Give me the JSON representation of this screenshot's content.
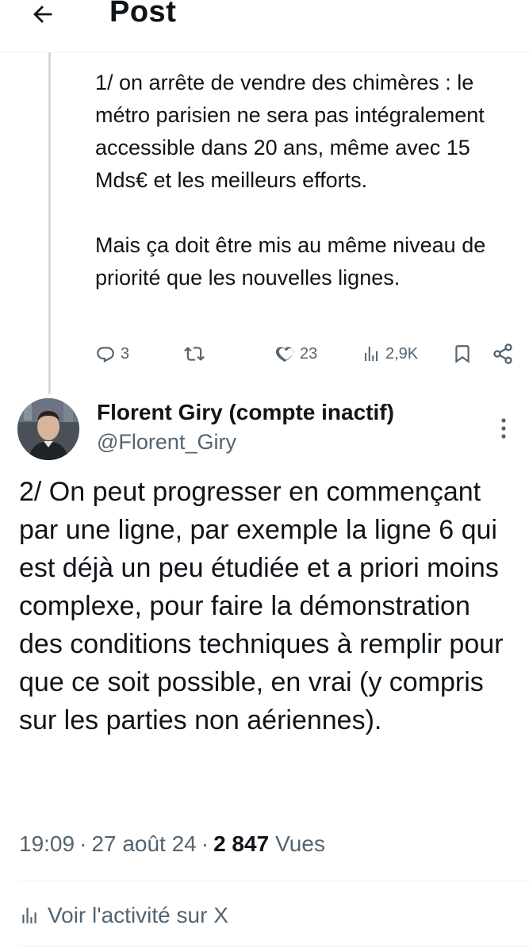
{
  "header": {
    "title": "Post",
    "back_icon": "arrow-left-icon"
  },
  "previous_post": {
    "text": "1/ on arrête de vendre des chimères : le métro parisien ne sera pas intégralement accessible dans 20 ans, même avec 15 Mds€ et les meilleurs efforts.\n\nMais ça doit être mis au même niveau de priorité que les nouvelles lignes.",
    "actions": {
      "replies": "3",
      "likes": "23",
      "views": "2,9K",
      "icons": [
        "reply-icon",
        "repost-icon",
        "like-icon",
        "views-icon",
        "bookmark-icon",
        "share-icon"
      ]
    }
  },
  "post": {
    "display_name": "Florent Giry (compte inactif)",
    "handle": "@Florent_Giry",
    "text": "2/ On peut progresser en commençant par une ligne, par exemple la ligne 6 qui est déjà un peu étudiée et a priori moins complexe, pour faire la démonstration des conditions techniques à remplir pour que ce soit possible, en vrai (y compris sur les parties non aériennes).",
    "time": "19:09",
    "date": "27 août 24",
    "views_count": "2 847",
    "views_label": "Vues",
    "separator": "·"
  },
  "activity": {
    "label": "Voir l'activité sur X",
    "icon": "analytics-icon"
  },
  "colors": {
    "text": "#0f1419",
    "secondary": "#536471",
    "divider": "#eff3f4",
    "thread_line": "#cfd9de"
  }
}
